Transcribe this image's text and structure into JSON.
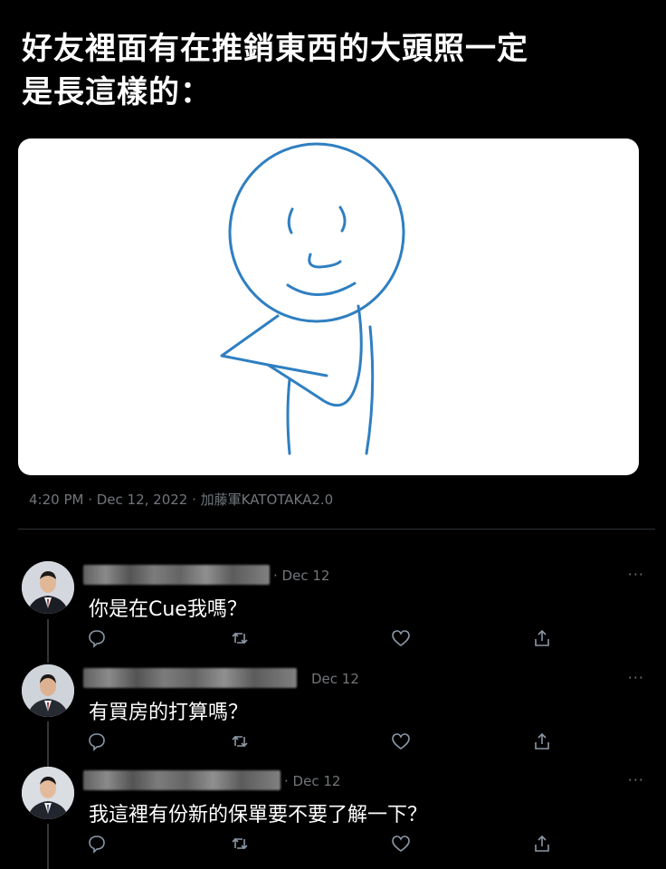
{
  "tweet": {
    "text_line1": "好友裡面有在推銷東西的大頭照一定",
    "text_line2": "是長這樣的：",
    "meta": "4:20 PM · Dec 12, 2022 · 加藤軍KATOTAKA2.0"
  },
  "replies": [
    {
      "date": "· Dec 12",
      "text": "你是在Cue我嗎？",
      "more": "···"
    },
    {
      "date": "Dec 12",
      "text": "有買房的打算嗎？",
      "more": "···"
    },
    {
      "date": "· Dec 12",
      "text": "我這裡有份新的保單要不要了解一下？",
      "more": "···"
    }
  ],
  "icons": {
    "reply": "speech-bubble-icon",
    "retweet": "retweet-icon",
    "like": "heart-icon",
    "share": "share-icon"
  },
  "colors": {
    "background": "#000000",
    "drawing_stroke": "#2f7fc1",
    "muted_text": "#71767b"
  }
}
